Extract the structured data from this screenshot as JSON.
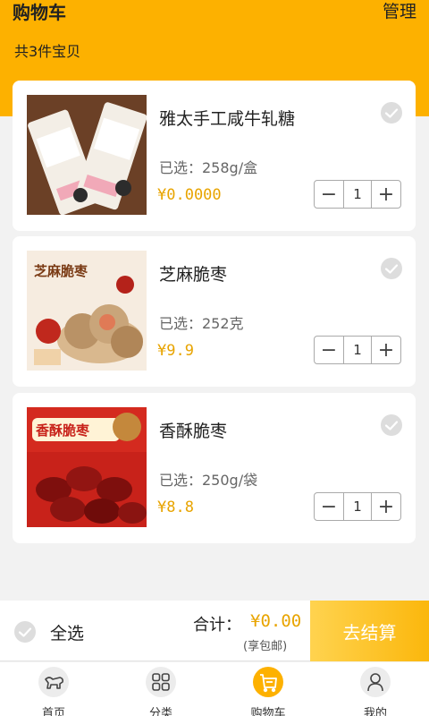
{
  "header": {
    "title": "购物车",
    "manage_label": "管理",
    "item_count_text": "共3件宝贝"
  },
  "cart": {
    "items": [
      {
        "name": "雅太手工咸牛轧糖",
        "spec": "已选：258g/盒",
        "price": "¥0.0000",
        "quantity": "1",
        "image_icon": "nougat-candy-image"
      },
      {
        "name": "芝麻脆枣",
        "spec": "已选：252克",
        "price": "¥9.9",
        "quantity": "1",
        "image_icon": "sesame-jujube-image",
        "image_text": "芝麻脆枣"
      },
      {
        "name": "香酥脆枣",
        "spec": "已选：250g/袋",
        "price": "¥8.8",
        "quantity": "1",
        "image_icon": "crispy-jujube-image",
        "image_text": "香酥脆枣"
      }
    ]
  },
  "checkout": {
    "select_all_label": "全选",
    "total_label": "合计：",
    "total_amount": "¥0.00",
    "shipping_note": "(享包邮)",
    "checkout_button": "去结算"
  },
  "tabs": [
    {
      "label": "首页",
      "icon": "home-dog-icon",
      "active": false
    },
    {
      "label": "分类",
      "icon": "category-grid-icon",
      "active": false
    },
    {
      "label": "购物车",
      "icon": "cart-icon",
      "active": true
    },
    {
      "label": "我的",
      "icon": "user-icon",
      "active": false
    }
  ],
  "colors": {
    "accent": "#fdb100",
    "price": "#e8a400",
    "checkout_gradient_start": "#ffd34f",
    "checkout_gradient_end": "#fbb70c"
  }
}
